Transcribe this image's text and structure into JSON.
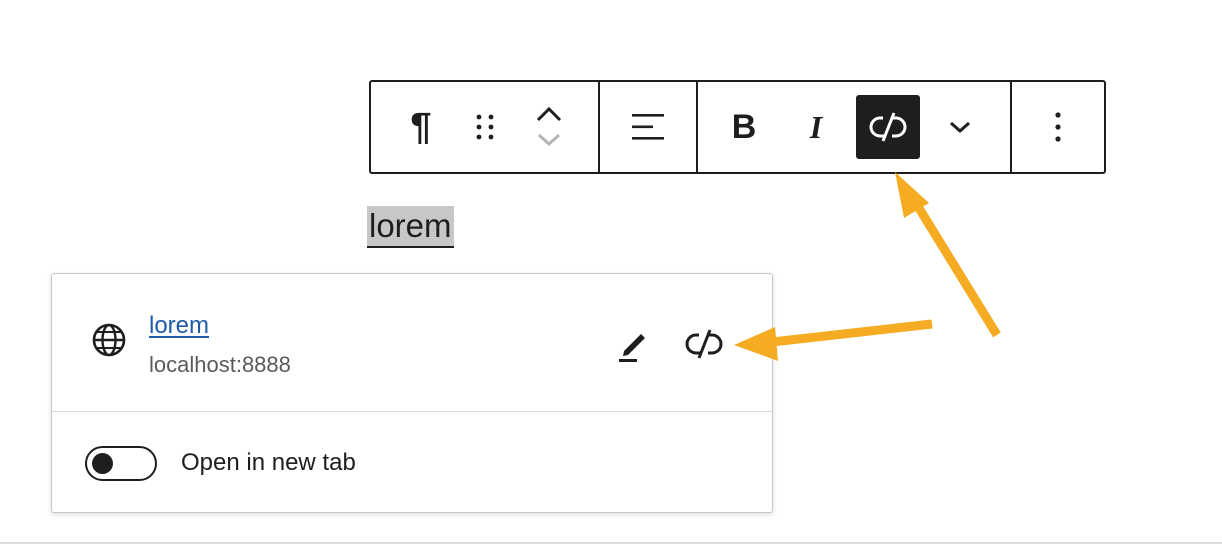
{
  "toolbar": {
    "paragraph_glyph": "¶",
    "bold_glyph": "B",
    "italic_glyph": "I",
    "icons": [
      "paragraph-icon",
      "drag-handle-icon",
      "move-up-icon",
      "move-down-icon",
      "align-icon",
      "bold-icon",
      "italic-icon",
      "unlink-icon",
      "chevron-down-icon",
      "more-vertical-icon"
    ]
  },
  "editor": {
    "paragraph_text": "lorem"
  },
  "link_popover": {
    "title": "lorem",
    "url": "localhost:8888",
    "toggle_label": "Open in new tab",
    "toggle_on": false
  },
  "colors": {
    "accent_arrow": "#F5AC23",
    "link": "#1F5BA7",
    "active_button": "#1E1E1E"
  }
}
